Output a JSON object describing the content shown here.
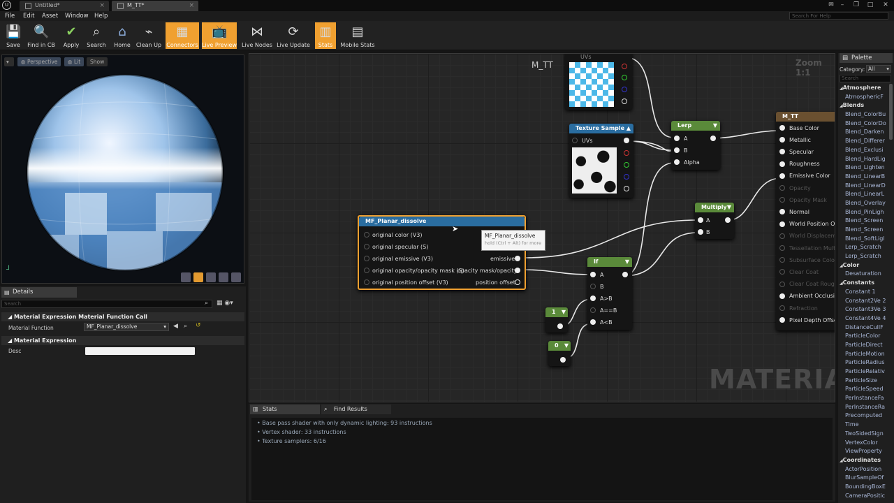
{
  "tabs": [
    {
      "label": "Untitled*"
    },
    {
      "label": "M_TT*"
    }
  ],
  "menu": [
    "File",
    "Edit",
    "Asset",
    "Window",
    "Help"
  ],
  "search_help": "Search For Help",
  "toolbar": [
    {
      "label": "Save",
      "icon": "save-icon"
    },
    {
      "label": "Find in CB",
      "icon": "find-icon"
    },
    {
      "label": "Apply",
      "icon": "check-icon"
    },
    {
      "label": "Search",
      "icon": "search-icon"
    },
    {
      "label": "Home",
      "icon": "home-icon"
    },
    {
      "label": "Clean Up",
      "icon": "broom-icon"
    },
    {
      "label": "Connectors",
      "icon": "connectors-icon",
      "active": true
    },
    {
      "label": "Live Preview",
      "icon": "tv-icon",
      "active": true
    },
    {
      "label": "Live Nodes",
      "icon": "nodes-icon"
    },
    {
      "label": "Live Update",
      "icon": "refresh-icon"
    },
    {
      "label": "Stats",
      "icon": "stats-icon",
      "active": true
    },
    {
      "label": "Mobile Stats",
      "icon": "mobile-stats-icon"
    }
  ],
  "viewport": {
    "perspective": "Perspective",
    "lit": "Lit",
    "show": "Show"
  },
  "details": {
    "tab": "Details",
    "search": "Search",
    "section1": "Material Expression Material Function Call",
    "material_function_label": "Material Function",
    "material_function_value": "MF_Planar_dissolve",
    "section2": "Material Expression",
    "desc_label": "Desc"
  },
  "graph": {
    "title": "M_TT",
    "zoom": "Zoom 1:1",
    "watermark": "MATERIAL"
  },
  "nodes": {
    "uvs_top": "UVs",
    "texture_sample": {
      "title": "Texture Sample",
      "uvs": "UVs"
    },
    "lerp": {
      "title": "Lerp",
      "a": "A",
      "b": "B",
      "alpha": "Alpha"
    },
    "multiply": {
      "title": "Multiply",
      "a": "A",
      "b": "B"
    },
    "mf": {
      "title": "MF_Planar_dissolve",
      "inputs": [
        "original color (V3)",
        "original specular (S)",
        "original emissive (V3)",
        "original opacity/opacity mask (S)",
        "original position offset (V3)"
      ],
      "outputs": [
        "emissive",
        "opacity mask/opacity",
        "position offset"
      ]
    },
    "tooltip": {
      "title": "MF_Planar_dissolve",
      "hint": "hold (Ctrl + Alt) for more"
    },
    "if": {
      "title": "If",
      "pins": [
        "A",
        "B",
        "A>B",
        "A==B",
        "A<B"
      ]
    },
    "const1": "1",
    "const0": "0",
    "result": {
      "title": "M_TT",
      "pins": [
        {
          "label": "Base Color",
          "on": true
        },
        {
          "label": "Metallic",
          "on": true
        },
        {
          "label": "Specular",
          "on": true
        },
        {
          "label": "Roughness",
          "on": true
        },
        {
          "label": "Emissive Color",
          "on": true
        },
        {
          "label": "Opacity",
          "on": false
        },
        {
          "label": "Opacity Mask",
          "on": false
        },
        {
          "label": "Normal",
          "on": true
        },
        {
          "label": "World Position Offset",
          "on": true
        },
        {
          "label": "World Displacement",
          "on": false
        },
        {
          "label": "Tessellation Multiplier",
          "on": false
        },
        {
          "label": "Subsurface Color",
          "on": false
        },
        {
          "label": "Clear Coat",
          "on": false
        },
        {
          "label": "Clear Coat Roughness",
          "on": false
        },
        {
          "label": "Ambient Occlusion",
          "on": true
        },
        {
          "label": "Refraction",
          "on": false
        },
        {
          "label": "Pixel Depth Offset",
          "on": true
        }
      ]
    }
  },
  "bottom": {
    "tab_stats": "Stats",
    "tab_find": "Find Results",
    "stats": [
      "Base pass shader with only dynamic lighting: 93 instructions",
      "Vertex shader: 33 instructions",
      "Texture samplers: 6/16"
    ]
  },
  "palette": {
    "title": "Palette",
    "category_label": "Category:",
    "category_value": "All",
    "search": "Search",
    "items": [
      {
        "t": "Atmosphere",
        "cat": true
      },
      {
        "t": "AtmosphericF"
      },
      {
        "t": "Blends",
        "cat": true
      },
      {
        "t": "Blend_ColorBu"
      },
      {
        "t": "Blend_ColorDo"
      },
      {
        "t": "Blend_Darken"
      },
      {
        "t": "Blend_Differer"
      },
      {
        "t": "Blend_Exclusi"
      },
      {
        "t": "Blend_HardLig"
      },
      {
        "t": "Blend_Lighten"
      },
      {
        "t": "Blend_LinearB"
      },
      {
        "t": "Blend_LinearD"
      },
      {
        "t": "Blend_LinearL"
      },
      {
        "t": "Blend_Overlay"
      },
      {
        "t": "Blend_PinLigh"
      },
      {
        "t": "Blend_Screen"
      },
      {
        "t": "Blend_Screen"
      },
      {
        "t": "Blend_SoftLigl"
      },
      {
        "t": "Lerp_Scratch"
      },
      {
        "t": "Lerp_Scratch"
      },
      {
        "t": "Color",
        "cat": true
      },
      {
        "t": "Desaturation"
      },
      {
        "t": "Constants",
        "cat": true
      },
      {
        "t": "Constant     1"
      },
      {
        "t": "Constant2Ve 2"
      },
      {
        "t": "Constant3Ve 3"
      },
      {
        "t": "Constant4Ve 4"
      },
      {
        "t": "DistanceCullF"
      },
      {
        "t": "ParticleColor"
      },
      {
        "t": "ParticleDirect"
      },
      {
        "t": "ParticleMotion"
      },
      {
        "t": "ParticleRadius"
      },
      {
        "t": "ParticleRelativ"
      },
      {
        "t": "ParticleSize"
      },
      {
        "t": "ParticleSpeed"
      },
      {
        "t": "PerInstanceFa"
      },
      {
        "t": "PerInstanceRa"
      },
      {
        "t": "Precomputed"
      },
      {
        "t": "Time"
      },
      {
        "t": "TwoSidedSign"
      },
      {
        "t": "VertexColor"
      },
      {
        "t": "ViewProperty"
      },
      {
        "t": "Coordinates",
        "cat": true
      },
      {
        "t": "ActorPosition"
      },
      {
        "t": "BlurSampleOf"
      },
      {
        "t": "BoundingBoxE"
      },
      {
        "t": "CameraPositic"
      }
    ]
  }
}
